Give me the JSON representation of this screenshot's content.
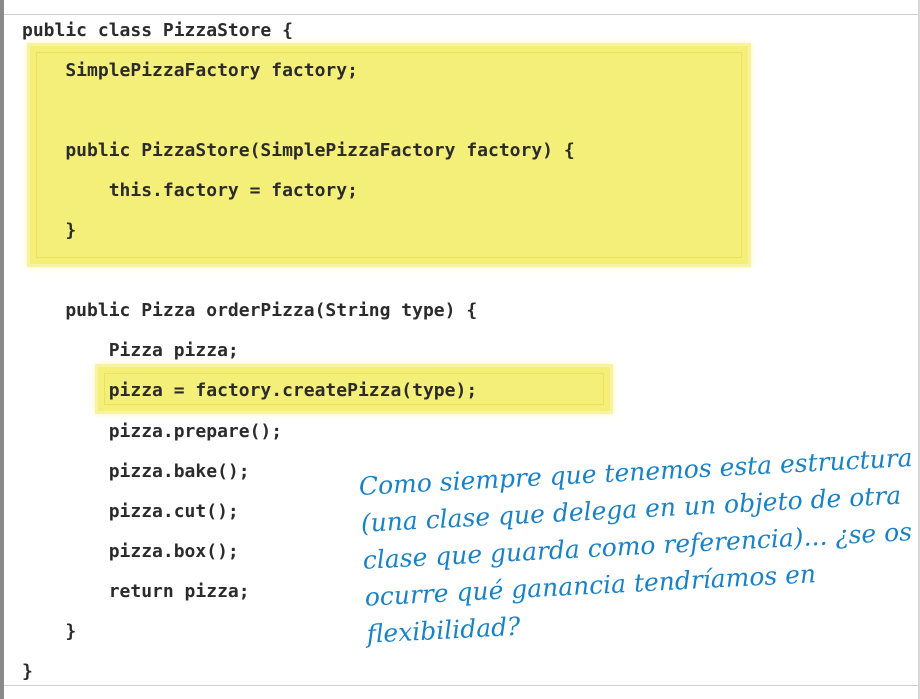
{
  "code": {
    "lines": [
      "public class PizzaStore {",
      "    SimplePizzaFactory factory;",
      "",
      "    public PizzaStore(SimplePizzaFactory factory) {",
      "        this.factory = factory;",
      "    }",
      "",
      "    public Pizza orderPizza(String type) {",
      "        Pizza pizza;",
      "        pizza = factory.createPizza(type);",
      "        pizza.prepare();",
      "        pizza.bake();",
      "        pizza.cut();",
      "        pizza.box();",
      "        return pizza;",
      "    }",
      "}"
    ]
  },
  "annotation": {
    "lines": [
      "Como siempre que tenemos esta estructura",
      "(una clase que delega en un objeto de otra",
      "clase que guarda como referencia)... ¿se os",
      "ocurre qué ganancia tendríamos en",
      "flexibilidad?"
    ]
  },
  "colors": {
    "highlight": "#f4ee6e",
    "annotation": "#1a82c4",
    "code": "#2b2b2b"
  }
}
